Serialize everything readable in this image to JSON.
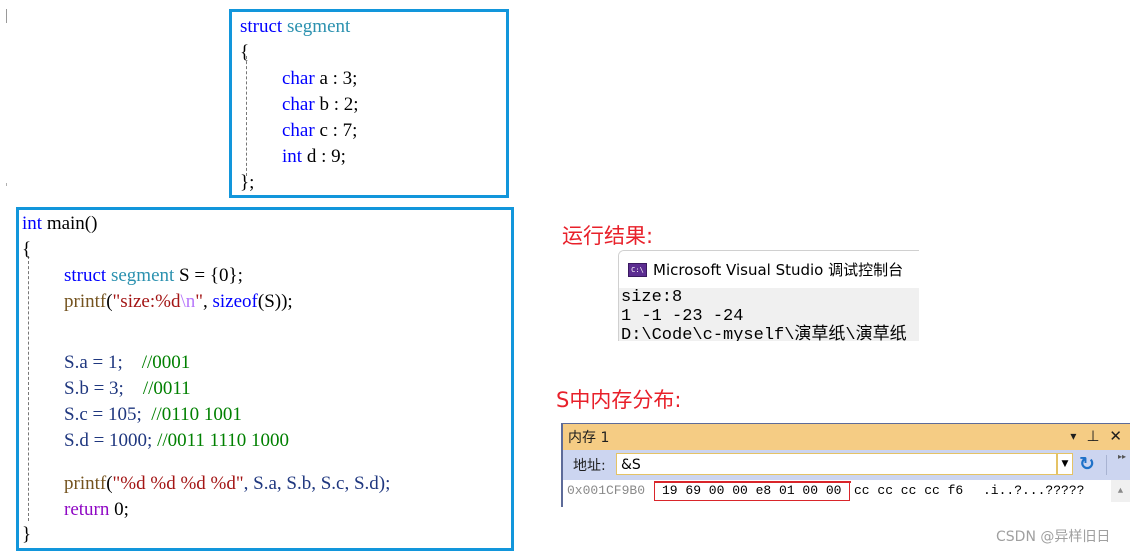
{
  "struct_box": {
    "lines": [
      {
        "kw": "struct",
        "ty": "segment"
      },
      {
        "text": "{"
      },
      {
        "kw": "char",
        "rest": " a : 3;"
      },
      {
        "kw": "char",
        "rest": " b : 2;"
      },
      {
        "kw": "char",
        "rest": " c : 7;"
      },
      {
        "kw": "int",
        "rest": " d : 9;"
      },
      {
        "text": "};"
      }
    ]
  },
  "main_box": {
    "sig_kw": "int",
    "sig_rest": " main()",
    "open": "{",
    "decl_kw": "struct",
    "decl_ty": "segment",
    "decl_rest": " S = {0};",
    "printf1_fn": "printf",
    "printf1_open": "(",
    "printf1_str_a": "\"size:%d",
    "printf1_esc": "\\n",
    "printf1_str_b": "\"",
    "printf1_mid": ", ",
    "printf1_sizeof": "sizeof",
    "printf1_end": "(S));",
    "assignments": [
      {
        "code": "S.a = 1;    ",
        "comment": "//0001"
      },
      {
        "code": "S.b = 3;    ",
        "comment": "//0011"
      },
      {
        "code": "S.c = 105;  ",
        "comment": "//0110 1001"
      },
      {
        "code": "S.d = 1000; ",
        "comment": "//0011 1110 1000"
      }
    ],
    "printf2_fn": "printf",
    "printf2_open": "(",
    "printf2_str": "\"%d %d %d %d\"",
    "printf2_args": ", S.a, S.b, S.c, S.d);",
    "return_kw": "return",
    "return_rest": " 0;",
    "close": "}"
  },
  "result_label": "运行结果:",
  "console": {
    "icon_text": "C:\\",
    "title": "Microsoft Visual Studio 调试控制台",
    "output_lines": [
      "size:8",
      "1 -1 -23 -24",
      "D:\\Code\\c-myself\\演草纸\\演草纸"
    ]
  },
  "memory_label": "S中内存分布:",
  "memory_window": {
    "title": "内存 1",
    "title_icons": [
      "▾",
      "⊥",
      "✕"
    ],
    "address_label": "地址:",
    "address_value": "&S",
    "row_address": "0x001CF9B0",
    "highlighted_bytes": "19 69 00 00 e8 01 00 00",
    "other_bytes": "cc cc cc cc f6",
    "ascii": ".i..?...?????"
  },
  "watermark": "CSDN @异样旧日"
}
